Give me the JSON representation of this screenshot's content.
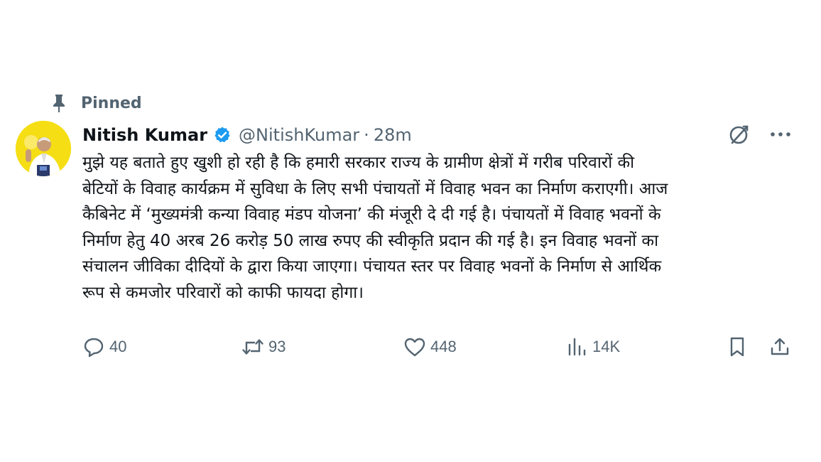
{
  "pinned": {
    "label": "Pinned"
  },
  "author": {
    "display_name": "Nitish Kumar",
    "handle": "@NitishKumar",
    "separator": "·",
    "time": "28m",
    "verified_color": "#1d9bf0"
  },
  "tweet": {
    "text": "मुझे यह बताते हुए खुशी हो रही है कि हमारी सरकार राज्य के ग्रामीण क्षेत्रों में गरीब परिवारों की\nबेटियों के विवाह कार्यक्रम में सुविधा के लिए सभी पंचायतों में विवाह भवन का निर्माण कराएगी। आज\nकैबिनेट में ‘मुख्यमंत्री कन्या विवाह मंडप योजना’ की मंजूरी दे दी गई है। पंचायतों में विवाह भवनों के\nनिर्माण हेतु 40 अरब 26 करोड़ 50 लाख रुपए की स्वीकृति प्रदान की गई है। इन विवाह भवनों का\nसंचालन जीविका दीदियों के द्वारा किया जाएगा। पंचायत स्तर पर विवाह भवनों के निर्माण से आर्थिक\nरूप से कमजोर परिवारों को काफी फायदा होगा।"
  },
  "actions": {
    "replies": "40",
    "retweets": "93",
    "likes": "448",
    "views": "14K"
  },
  "icons": {
    "pin": "pin-icon",
    "verified": "verified-badge-icon",
    "grok": "grok-icon",
    "more": "more-icon",
    "reply": "reply-icon",
    "retweet": "retweet-icon",
    "like": "heart-icon",
    "views": "views-icon",
    "bookmark": "bookmark-icon",
    "share": "share-icon"
  },
  "colors": {
    "text": "#0f1419",
    "secondary": "#536471",
    "avatar_bg": "#f5de14"
  }
}
